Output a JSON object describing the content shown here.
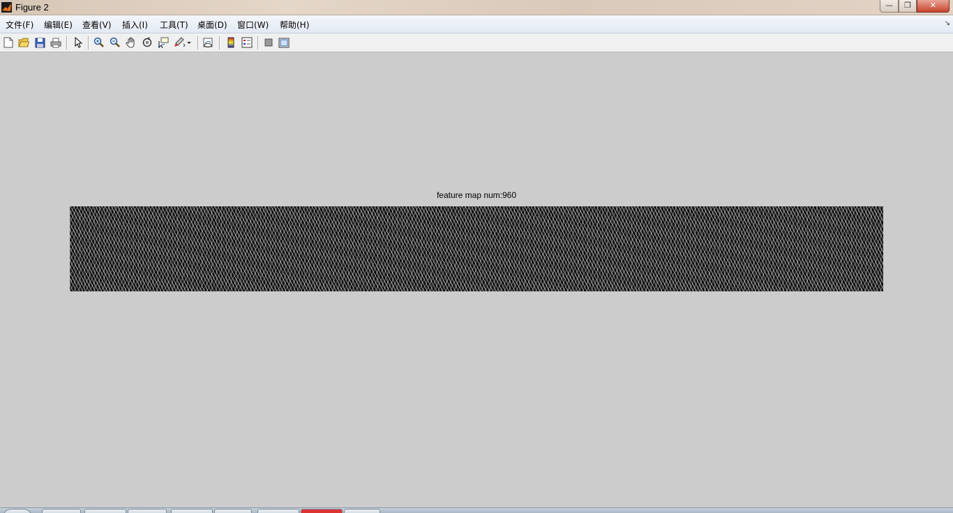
{
  "window": {
    "title": "Figure 2",
    "controls": {
      "minimize": "—",
      "maximize": "❐",
      "close": "✕"
    }
  },
  "menu": [
    "文件(F)",
    "编辑(E)",
    "查看(V)",
    "插入(I)",
    "工具(T)",
    "桌面(D)",
    "窗口(W)",
    "帮助(H)"
  ],
  "toolbar": {
    "icons": [
      "new-figure-icon",
      "open-file-icon",
      "save-icon",
      "print-icon",
      "edit-plot-icon",
      "zoom-in-icon",
      "zoom-out-icon",
      "pan-icon",
      "rotate-3d-icon",
      "data-cursor-icon",
      "brush-icon",
      "link-plot-icon",
      "insert-colorbar-icon",
      "insert-legend-icon",
      "hide-plot-tools-icon",
      "show-plot-tools-icon"
    ]
  },
  "figure": {
    "axes_title": "feature map num:960"
  },
  "colors": {
    "figure_background": "#cccccc",
    "image_dark": "#111111",
    "close_button": "#c7442d"
  }
}
